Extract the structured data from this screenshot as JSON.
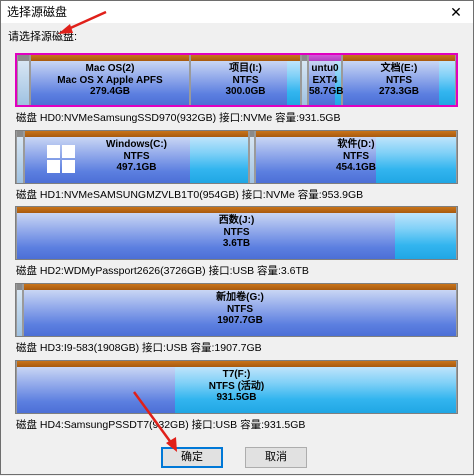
{
  "window": {
    "title": "选择源磁盘",
    "close_glyph": "✕"
  },
  "prompt": "请选择源磁盘:",
  "disks": [
    {
      "label": "磁盘 HD0:NVMeSamsungSSD970(932GB)  接口:NVMe  容量:931.5GB",
      "partitions": [
        {
          "name": "Mac OS(2)",
          "fs": "Mac OS X Apple APFS",
          "size": "279.4GB"
        },
        {
          "name": "项目(I:)",
          "fs": "NTFS",
          "size": "300.0GB"
        },
        {
          "name": "untu0",
          "fs": "EXT4",
          "size": "58.7GB"
        },
        {
          "name": "文档(E:)",
          "fs": "NTFS",
          "size": "273.3GB"
        }
      ]
    },
    {
      "label": "磁盘 HD1:NVMeSAMSUNGMZVLB1T0(954GB)  接口:NVMe  容量:953.9GB",
      "partitions": [
        {
          "name": "Windows(C:)",
          "fs": "NTFS",
          "size": "497.1GB"
        },
        {
          "name": "软件(D:)",
          "fs": "NTFS",
          "size": "454.1GB"
        }
      ]
    },
    {
      "label": "磁盘 HD2:WDMyPassport2626(3726GB)  接口:USB  容量:3.6TB",
      "partitions": [
        {
          "name": "西数(J:)",
          "fs": "NTFS",
          "size": "3.6TB"
        }
      ]
    },
    {
      "label": "磁盘 HD3:I9-583(1908GB)  接口:USB  容量:1907.7GB",
      "partitions": [
        {
          "name": "新加卷(G:)",
          "fs": "NTFS",
          "size": "1907.7GB"
        }
      ]
    },
    {
      "label": "磁盘 HD4:SamsungPSSDT7(932GB)  接口:USB  容量:931.5GB",
      "partitions": [
        {
          "name": "T7(F:)",
          "fs": "NTFS (活动)",
          "size": "931.5GB"
        }
      ]
    }
  ],
  "buttons": {
    "ok": "确定",
    "cancel": "取消"
  },
  "colors": {
    "selected_border": "#e000c0",
    "annotation_arrow": "#e0201a",
    "focus_border": "#0078d7"
  }
}
